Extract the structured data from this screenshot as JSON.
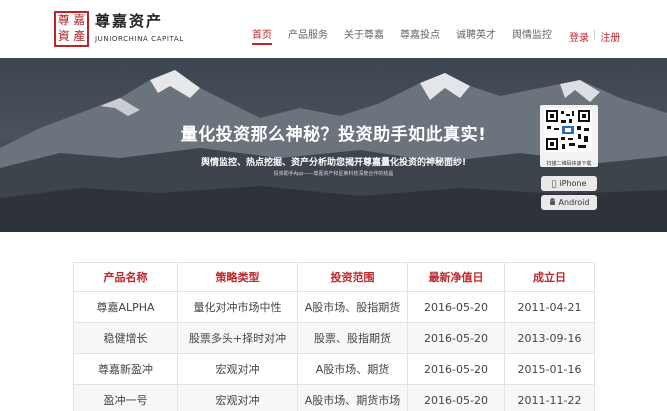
{
  "brand": {
    "seal_chars": [
      "尊",
      "嘉",
      "資",
      "產"
    ],
    "name": "尊嘉资产",
    "name_en": "JUNIORCHINA CAPITAL"
  },
  "nav": {
    "items": [
      {
        "label": "首页",
        "active": true
      },
      {
        "label": "产品服务",
        "active": false
      },
      {
        "label": "关于尊嘉",
        "active": false
      },
      {
        "label": "尊嘉投点",
        "active": false
      },
      {
        "label": "诚聘英才",
        "active": false
      },
      {
        "label": "舆情监控",
        "active": false
      }
    ]
  },
  "auth": {
    "login": "登录",
    "separator": "|",
    "register": "注册"
  },
  "hero": {
    "title": "量化投资那么神秘？投资助手如此真实!",
    "subtitle": "舆情监控、热点挖掘、资产分析助您揭开尊嘉量化投资的神秘面纱!",
    "small": "投资助手App——尊嘉资产和星莱科技深度合作的结晶",
    "qr_label": "扫描二维码快速下载",
    "iphone": "iPhone",
    "android": "Android"
  },
  "products_table": {
    "headers": [
      "产品名称",
      "策略类型",
      "投资范围",
      "最新净值日",
      "成立日"
    ],
    "rows": [
      [
        "尊嘉ALPHA",
        "量化对冲市场中性",
        "A股市场、股指期货",
        "2016-05-20",
        "2011-04-21"
      ],
      [
        "稳健增长",
        "股票多头+择时对冲",
        "股票、股指期货",
        "2016-05-20",
        "2013-09-16"
      ],
      [
        "尊嘉新盈冲",
        "宏观对冲",
        "A股市场、期货",
        "2016-05-20",
        "2015-01-16"
      ],
      [
        "盈冲一号",
        "宏观对冲",
        "A股市场、期货市场",
        "2016-05-20",
        "2011-11-22"
      ]
    ]
  },
  "colors": {
    "accent": "#c0252b"
  }
}
